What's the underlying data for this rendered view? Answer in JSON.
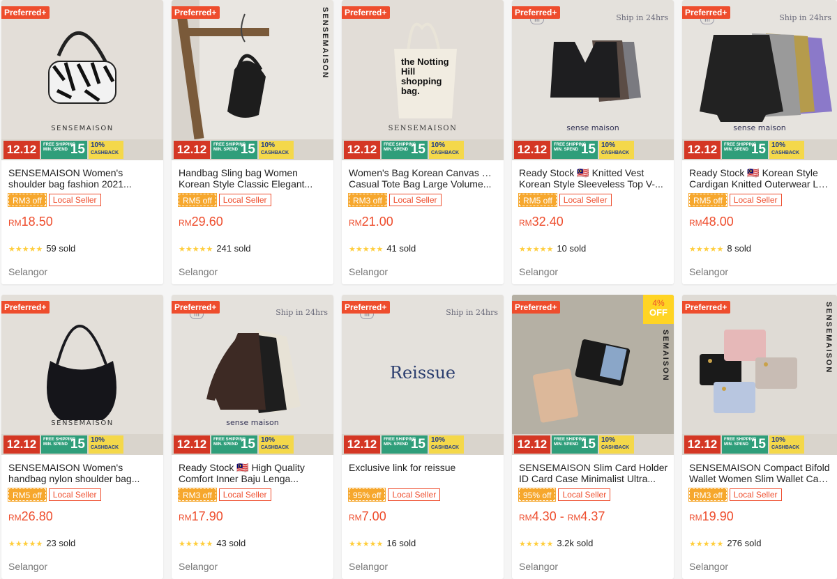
{
  "colors": {
    "accent": "#ee4d2d",
    "discount": "#f6a72d",
    "star": "#ffce3d"
  },
  "promo": {
    "date": "12.12",
    "free_shipping": "FREE SHIPPING",
    "min_spend": "MIN. SPEND",
    "free_amount": "15",
    "cashback_pct": "10%",
    "cashback": "CASHBACK"
  },
  "products": [
    {
      "preferred": "Preferred+",
      "brand": "SENSEMAISON",
      "name1": "SENSEMAISON Women's",
      "name2": "shoulder bag fashion 2021...",
      "discount": "RM3 off",
      "seller": "Local Seller",
      "currency": "RM",
      "price": "18.50",
      "stars": "★★★★★",
      "sold": "59 sold",
      "location": "Selangor"
    },
    {
      "preferred": "Preferred+",
      "brand": "SENSEMAISON",
      "name1": "Handbag Sling bag Women",
      "name2": "Korean Style Classic Elegant...",
      "discount": "RM5 off",
      "seller": "Local Seller",
      "currency": "RM",
      "price": "29.60",
      "stars": "★★★★★",
      "sold": "241 sold",
      "location": "Selangor"
    },
    {
      "preferred": "Preferred+",
      "brand": "SENSEMAISON",
      "tote": "the Notting Hill shopping bag.",
      "name1": "Women's Bag Korean Canvas Bag",
      "name2": "Casual Tote Bag Large Volume...",
      "discount": "RM3 off",
      "seller": "Local Seller",
      "currency": "RM",
      "price": "21.00",
      "stars": "★★★★★",
      "sold": "41 sold",
      "location": "Selangor"
    },
    {
      "preferred": "Preferred+",
      "ship": "Ship in 24hrs",
      "mark": "m",
      "brand": "sense maison",
      "name1": "Ready Stock 🇲🇾 Knitted Vest",
      "name2": "Korean Style Sleeveless Top V-...",
      "discount": "RM5 off",
      "seller": "Local Seller",
      "currency": "RM",
      "price": "32.40",
      "stars": "★★★★★",
      "sold": "10 sold",
      "location": "Selangor"
    },
    {
      "preferred": "Preferred+",
      "ship": "Ship in 24hrs",
      "mark": "m",
      "brand": "sense maison",
      "name1": "Ready Stock 🇲🇾 Korean Style",
      "name2": "Cardigan Knitted Outerwear Lon...",
      "discount": "RM5 off",
      "seller": "Local Seller",
      "currency": "RM",
      "price": "48.00",
      "stars": "★★★★★",
      "sold": "8 sold",
      "location": "Selangor"
    },
    {
      "preferred": "Preferred+",
      "brand": "SENSEMAISON",
      "name1": "SENSEMAISON Women's",
      "name2": "handbag nylon shoulder bag...",
      "discount": "RM5 off",
      "seller": "Local Seller",
      "currency": "RM",
      "price": "26.80",
      "stars": "★★★★★",
      "sold": "23 sold",
      "location": "Selangor"
    },
    {
      "preferred": "Preferred+",
      "ship": "Ship in 24hrs",
      "mark": "m",
      "brand": "sense maison",
      "name1": "Ready Stock 🇲🇾 High Quality",
      "name2": "Comfort Inner Baju Lenga...",
      "discount": "RM3 off",
      "seller": "Local Seller",
      "currency": "RM",
      "price": "17.90",
      "stars": "★★★★★",
      "sold": "43 sold",
      "location": "Selangor"
    },
    {
      "preferred": "Preferred+",
      "ship": "Ship in 24hrs",
      "mark": "m",
      "reissue": "Reissue",
      "name1": "Exclusive link for reissue",
      "name2": "",
      "discount": "95% off",
      "seller": "Local Seller",
      "currency": "RM",
      "price": "7.00",
      "stars": "★★★★★",
      "sold": "16 sold",
      "location": "Selangor"
    },
    {
      "preferred": "Preferred+",
      "brand": "SEMAISON",
      "off_pct": "4%",
      "off_label": "OFF",
      "name1": "SENSEMAISON Slim Card Holder",
      "name2": "ID Card Case Minimalist Ultra...",
      "discount": "95% off",
      "seller": "Local Seller",
      "currency": "RM",
      "price": "4.30 - ",
      "currency2": "RM",
      "price2": "4.37",
      "stars": "★★★★★",
      "sold": "3.2k sold",
      "location": "Selangor"
    },
    {
      "preferred": "Preferred+",
      "brand": "SENSEMAISON",
      "name1": "SENSEMAISON Compact Bifold",
      "name2": "Wallet Women Slim Wallet Casu...",
      "discount": "RM3 off",
      "seller": "Local Seller",
      "currency": "RM",
      "price": "19.90",
      "stars": "★★★★★",
      "sold": "276 sold",
      "location": "Selangor"
    }
  ]
}
